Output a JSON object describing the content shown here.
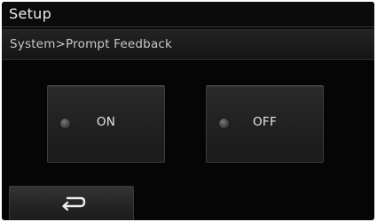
{
  "header": {
    "title": "Setup"
  },
  "breadcrumb": {
    "text": "System>Prompt Feedback"
  },
  "options": [
    {
      "label": "ON",
      "selected": false
    },
    {
      "label": "OFF",
      "selected": false
    }
  ],
  "footer": {
    "back_icon": "back-arrow-icon"
  },
  "colors": {
    "background": "#050505",
    "text": "#e6e6e6"
  }
}
